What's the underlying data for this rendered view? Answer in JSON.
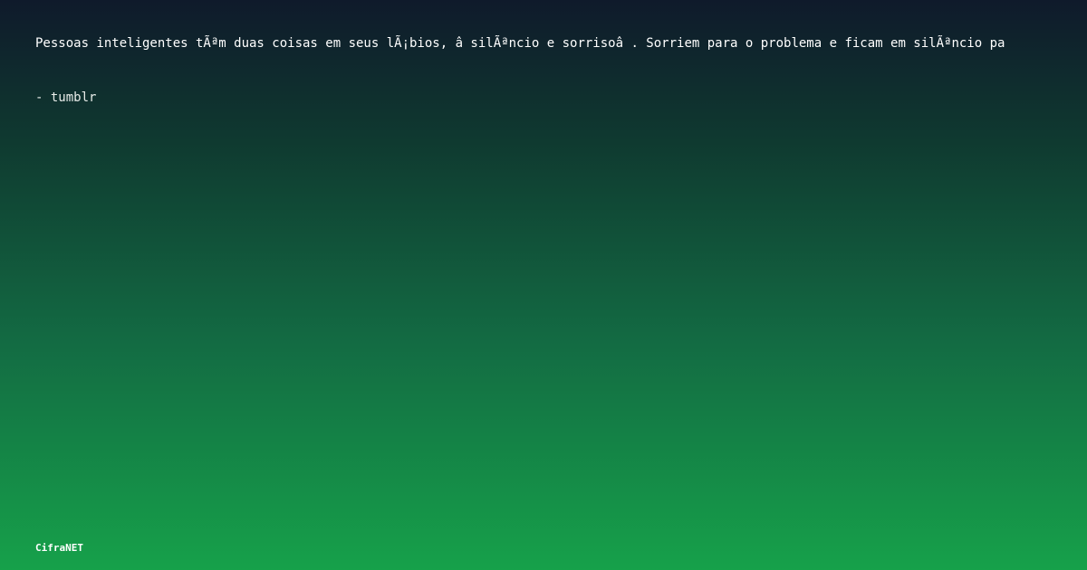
{
  "quote": {
    "text": "Pessoas inteligentes tÃªm duas coisas em seus lÃ¡bios, â  silÃªncio e sorrisoâ  . Sorriem para o problema e ficam em silÃªncio pa"
  },
  "attribution": {
    "text": "- tumblr"
  },
  "brand": {
    "name": "CifraNET"
  },
  "colors": {
    "background_top": "#0f1a2b",
    "background_bottom": "#16a14a",
    "text": "#ffffff"
  }
}
